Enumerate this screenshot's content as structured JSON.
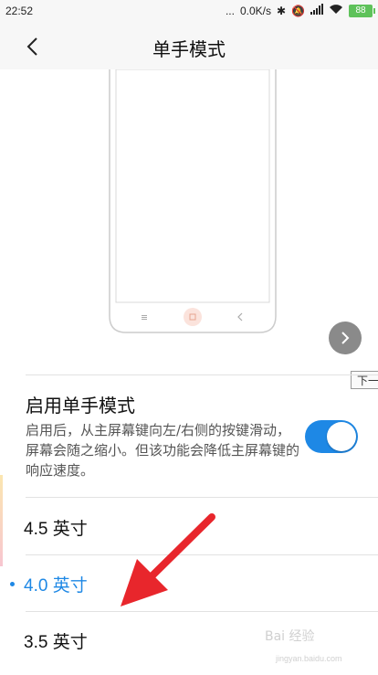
{
  "status_bar": {
    "time": "22:52",
    "dots": "...",
    "speed": "0.0K/s",
    "battery": "88"
  },
  "header": {
    "title": "单手模式"
  },
  "preview": {
    "next_tooltip": "下一"
  },
  "setting": {
    "title": "启用单手模式",
    "description": "启用后，从主屏幕键向左/右侧的按键滑动，屏幕会随之缩小。但该功能会降低主屏幕键的响应速度。",
    "enabled": true
  },
  "options": [
    {
      "label": "4.5 英寸",
      "selected": false
    },
    {
      "label": "4.0 英寸",
      "selected": true
    },
    {
      "label": "3.5 英寸",
      "selected": false
    }
  ],
  "watermark": {
    "logo": "Bai 经验",
    "sub": "jingyan.baidu.com"
  },
  "colors": {
    "accent": "#1e88e5",
    "arrow": "#e8262c",
    "toggle_on": "#1e88e5"
  },
  "icons": {
    "back": "chevron-left-icon",
    "next": "chevron-right-icon",
    "home_key": "home-key-icon"
  }
}
